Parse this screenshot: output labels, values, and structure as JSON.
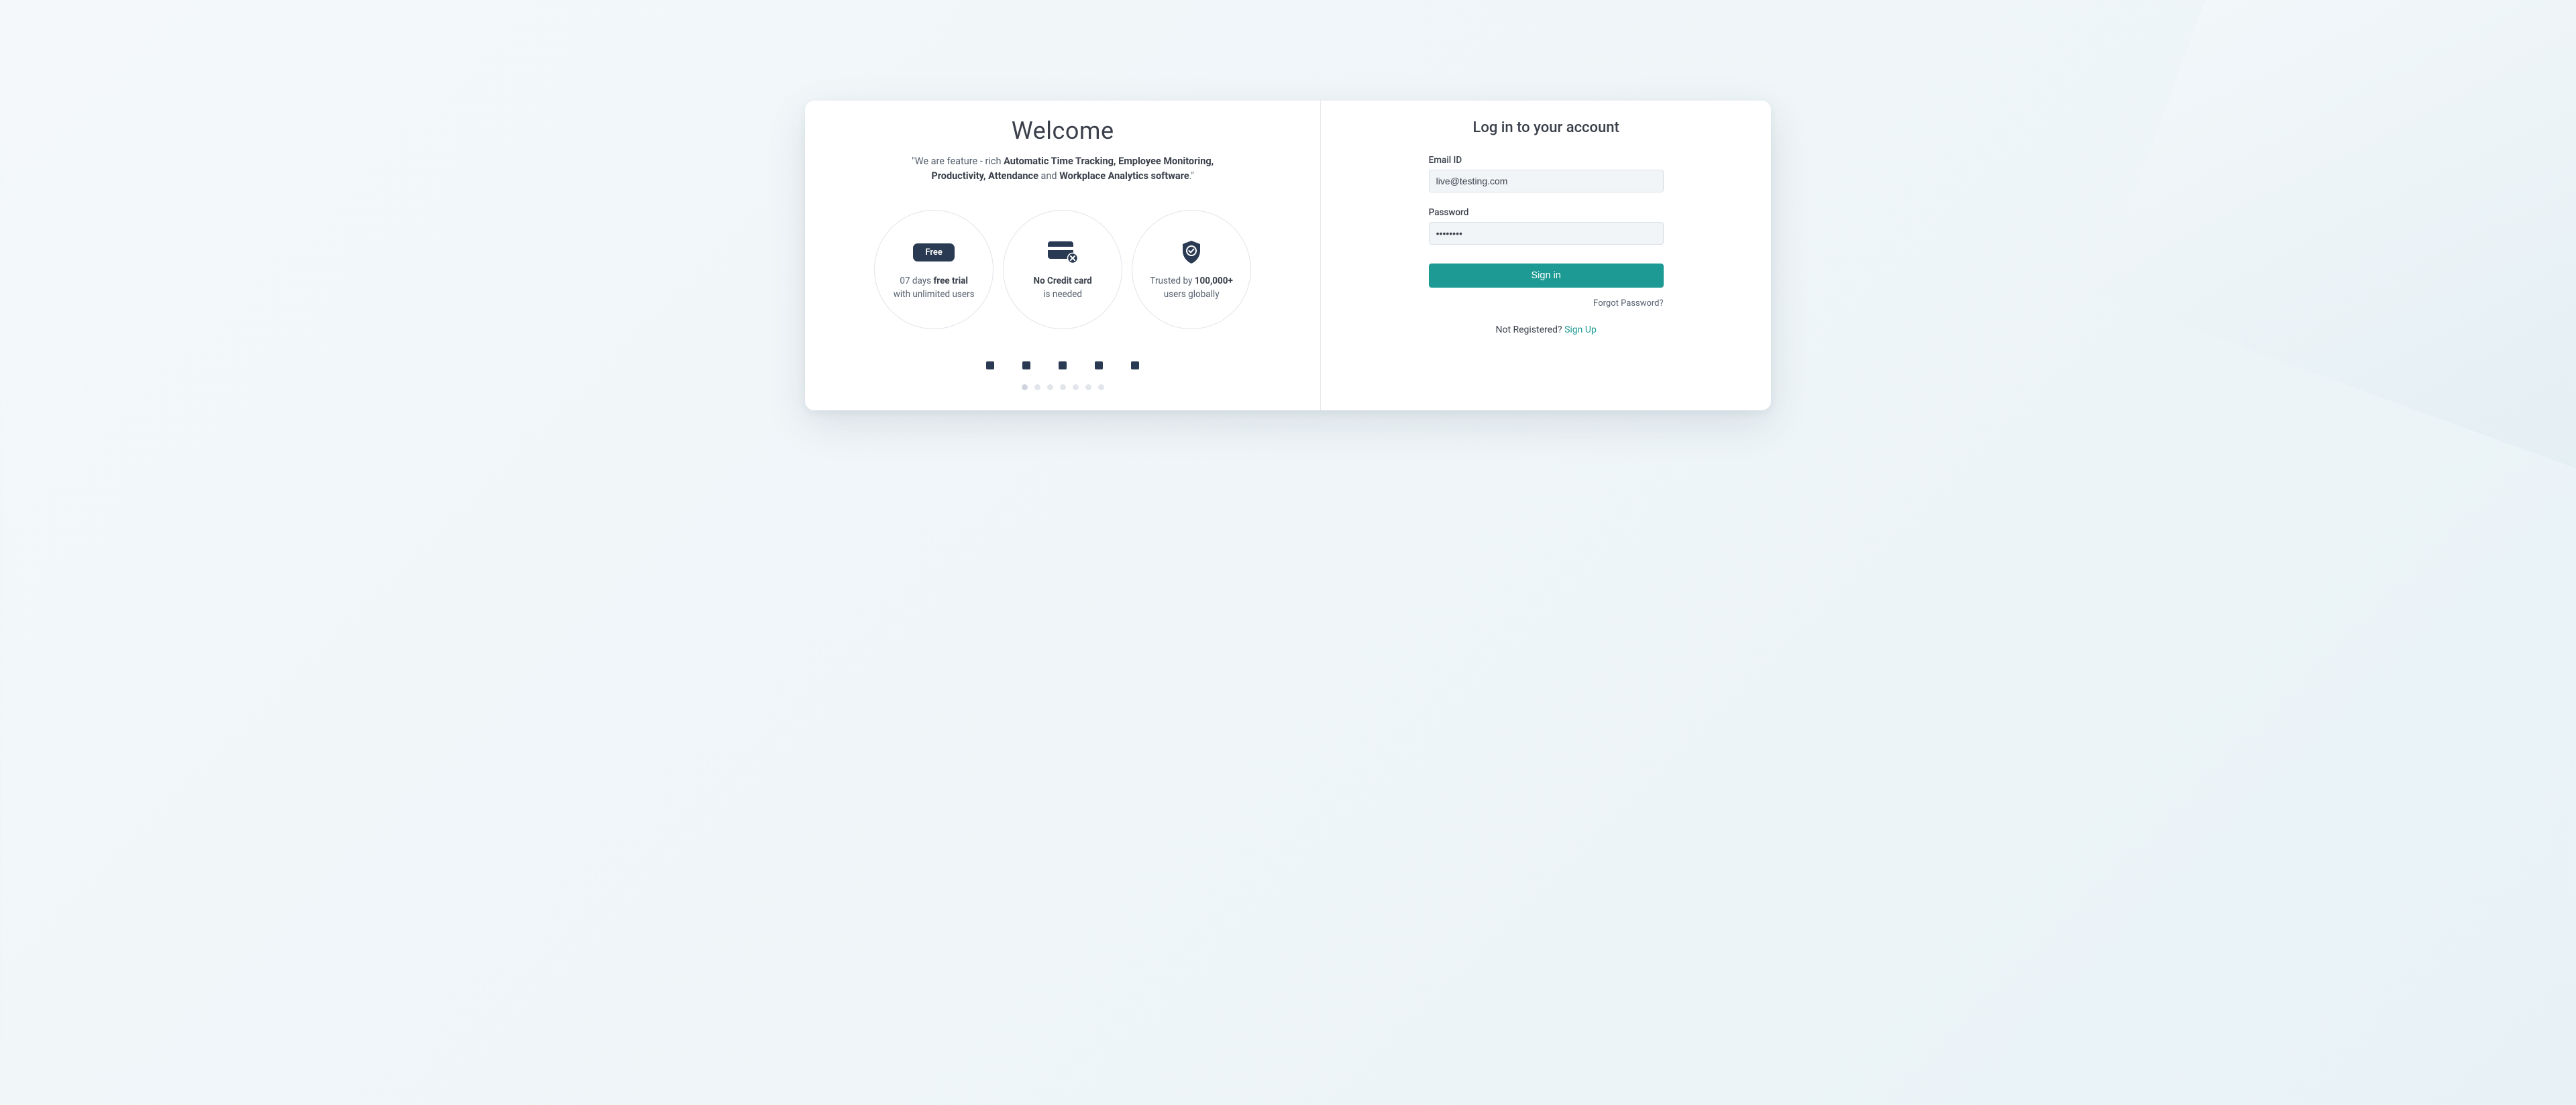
{
  "welcome": {
    "title": "Welcome",
    "tagline_prefix": "\"We are feature - rich ",
    "tagline_bold1": "Automatic Time Tracking, Employee Monitoring, Productivity, Attendance",
    "tagline_mid": " and ",
    "tagline_bold2": "Workplace Analytics software",
    "tagline_suffix": ".\""
  },
  "features": {
    "free_badge": "Free",
    "f1_line1a": "07 days ",
    "f1_line1b": "free trial",
    "f1_line2": "with unlimited users",
    "f2_line1a": "No Credit card",
    "f2_line2": "is needed",
    "f3_line1a": "Trusted by ",
    "f3_line1b": "100,000+",
    "f3_line2": "users globally"
  },
  "login": {
    "title": "Log in to your account",
    "email_label": "Email ID",
    "email_value": "live@testing.com",
    "password_label": "Password",
    "password_value": "••••••••",
    "signin_btn": "Sign in",
    "forgot": "Forgot Password?",
    "not_registered": "Not Registered? ",
    "signup": "Sign Up"
  },
  "colors": {
    "accent": "#1c9a93",
    "dark": "#2a3a52"
  }
}
